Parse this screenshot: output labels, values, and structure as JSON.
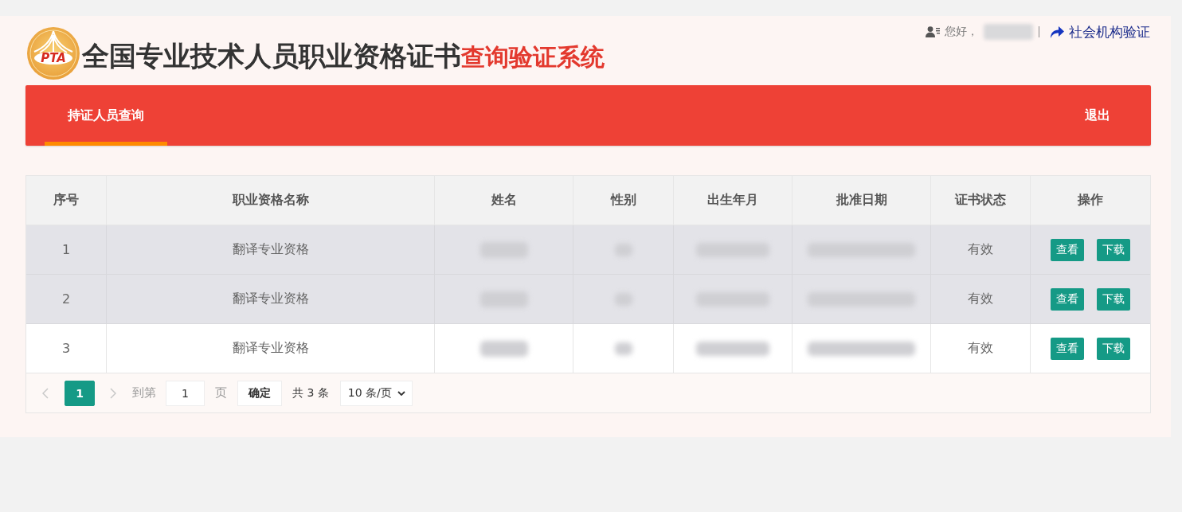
{
  "header": {
    "logo_text": "PTA",
    "title": "全国专业技术人员职业资格证书",
    "title_highlight": "查询验证系统",
    "greeting": "您好，",
    "org_link": "社会机构验证"
  },
  "nav": {
    "tabs": [
      {
        "label": "持证人员查询",
        "selected": true
      }
    ],
    "logout": "退出"
  },
  "table": {
    "columns": [
      "序号",
      "职业资格名称",
      "姓名",
      "性别",
      "出生年月",
      "批准日期",
      "证书状态",
      "操作"
    ],
    "rows": [
      {
        "highlighted": true,
        "cells": [
          {
            "kind": "text",
            "text": "1"
          },
          {
            "kind": "text",
            "text": "翻译专业资格"
          },
          {
            "kind": "redacted"
          },
          {
            "kind": "redacted"
          },
          {
            "kind": "redacted"
          },
          {
            "kind": "redacted"
          },
          {
            "kind": "text",
            "text": "有效"
          },
          {
            "kind": "actions",
            "buttons": [
              "查看",
              "下载"
            ]
          }
        ]
      },
      {
        "highlighted": true,
        "cells": [
          {
            "kind": "text",
            "text": "2"
          },
          {
            "kind": "text",
            "text": "翻译专业资格"
          },
          {
            "kind": "redacted"
          },
          {
            "kind": "redacted"
          },
          {
            "kind": "redacted"
          },
          {
            "kind": "redacted"
          },
          {
            "kind": "text",
            "text": "有效"
          },
          {
            "kind": "actions",
            "buttons": [
              "查看",
              "下载"
            ]
          }
        ]
      },
      {
        "highlighted": false,
        "cells": [
          {
            "kind": "text",
            "text": "3"
          },
          {
            "kind": "text",
            "text": "翻译专业资格"
          },
          {
            "kind": "redacted"
          },
          {
            "kind": "redacted"
          },
          {
            "kind": "redacted"
          },
          {
            "kind": "redacted"
          },
          {
            "kind": "text",
            "text": "有效"
          },
          {
            "kind": "actions",
            "buttons": [
              "查看",
              "下载"
            ]
          }
        ]
      }
    ]
  },
  "pagination": {
    "pages": [
      {
        "label": "1",
        "selected": true
      }
    ],
    "goto_label": "到第",
    "goto_value": "1",
    "page_unit": "页",
    "confirm": "确定",
    "total": "共 3 条",
    "page_size": "10 条/页"
  }
}
